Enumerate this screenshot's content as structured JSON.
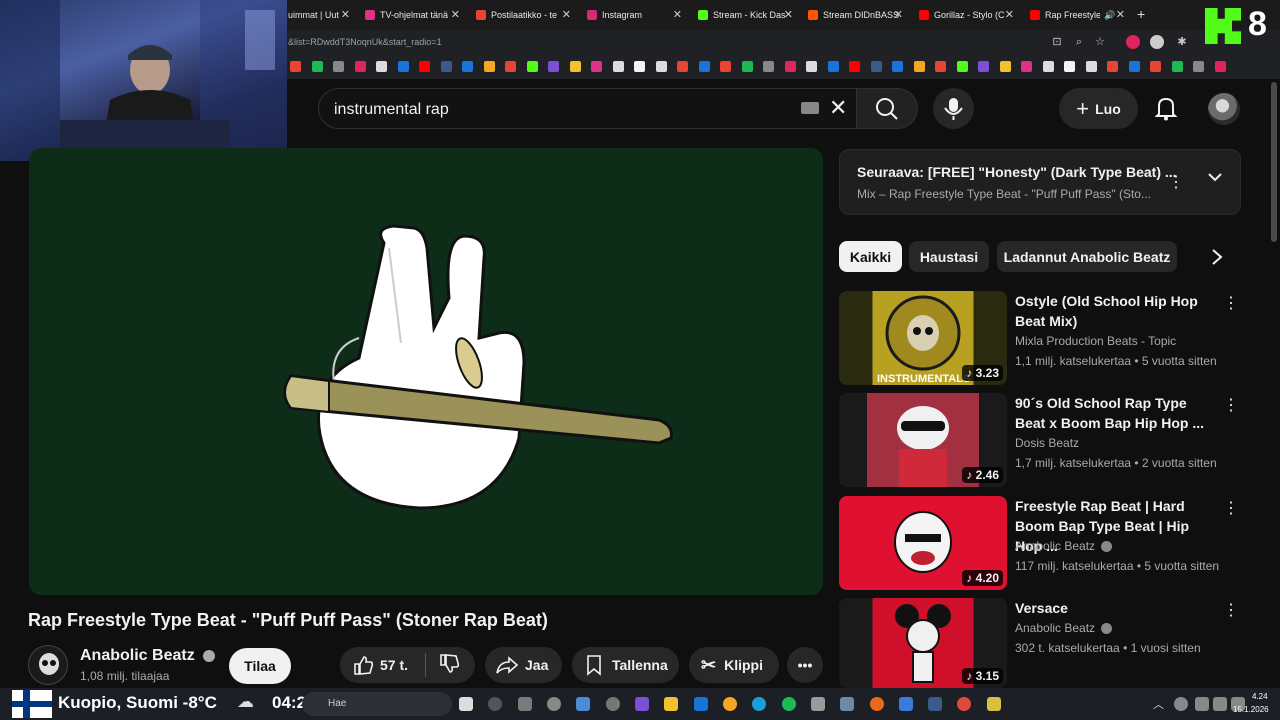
{
  "browser": {
    "tabs": [
      {
        "title": "uimmat | Uut",
        "color": "#888888"
      },
      {
        "title": "TV-ohjelmat tänä",
        "color": "#e0308a"
      },
      {
        "title": "Postilaatikko - te",
        "color": "#e84335"
      },
      {
        "title": "Instagram",
        "color": "#d62976"
      },
      {
        "title": "Stream - Kick Das",
        "color": "#53fc18"
      },
      {
        "title": "Stream DIDnBASS",
        "color": "#ff5500"
      },
      {
        "title": "Gorillaz - Stylo (C",
        "color": "#ff0000"
      },
      {
        "title": "Rap Freestyle",
        "color": "#ff0000"
      }
    ],
    "url": "&list=RDwddT3NoqnUk&start_radio=1"
  },
  "youtube": {
    "search_value": "instrumental rap",
    "create_label": "Luo",
    "video": {
      "title": "Rap Freestyle Type Beat - \"Puff Puff Pass\" (Stoner Rap Beat)",
      "channel": "Anabolic Beatz",
      "subscribers": "1,08 milj. tilaajaa",
      "subscribe_label": "Tilaa",
      "likes": "57 t.",
      "share_label": "Jaa",
      "save_label": "Tallenna",
      "clip_label": "Klippi"
    },
    "up_next": {
      "title": "Seuraava: [FREE] \"Honesty\" (Dark Type Beat) ...",
      "subtitle": "Mix – Rap Freestyle Type Beat - \"Puff Puff Pass\" (Sto..."
    },
    "chips": [
      "Kaikki",
      "Haustasi",
      "Ladannut Anabolic Beatz"
    ],
    "recommendations": [
      {
        "title": "Ostyle (Old School Hip Hop Beat Mix)",
        "channel": "Mixla Production Beats - Topic",
        "meta": "1,1 milj. katselukertaa • 5 vuotta sitten",
        "duration": "3.23",
        "thumb_label": "INSTRUMENTALS",
        "color": "#b8a020"
      },
      {
        "title": "90´s Old School Rap Type Beat x Boom Bap Hip Hop ...",
        "channel": "Dosis Beatz",
        "meta": "1,7 milj. katselukertaa • 2 vuotta sitten",
        "duration": "2.46",
        "thumb_label": "",
        "color": "#c03040"
      },
      {
        "title": "Freestyle Rap Beat | Hard Boom Bap Type Beat | Hip Hop ...",
        "channel": "Anabolic Beatz",
        "meta": "117 milj. katselukertaa • 5 vuotta sitten",
        "duration": "4.20",
        "thumb_label": "",
        "color": "#e01030"
      },
      {
        "title": "Versace",
        "channel": "Anabolic Beatz",
        "meta": "302 t. katselukertaa • 1 vuosi sitten",
        "duration": "3.15",
        "thumb_label": "",
        "color": "#d0102a"
      }
    ]
  },
  "taskbar": {
    "weather": "Kuopio, Suomi -8°C",
    "time_big": "04:24",
    "search_placeholder": "Hae",
    "clock_time": "4.24",
    "clock_date": "15.1.2026"
  },
  "overlay": {
    "number": "8"
  }
}
